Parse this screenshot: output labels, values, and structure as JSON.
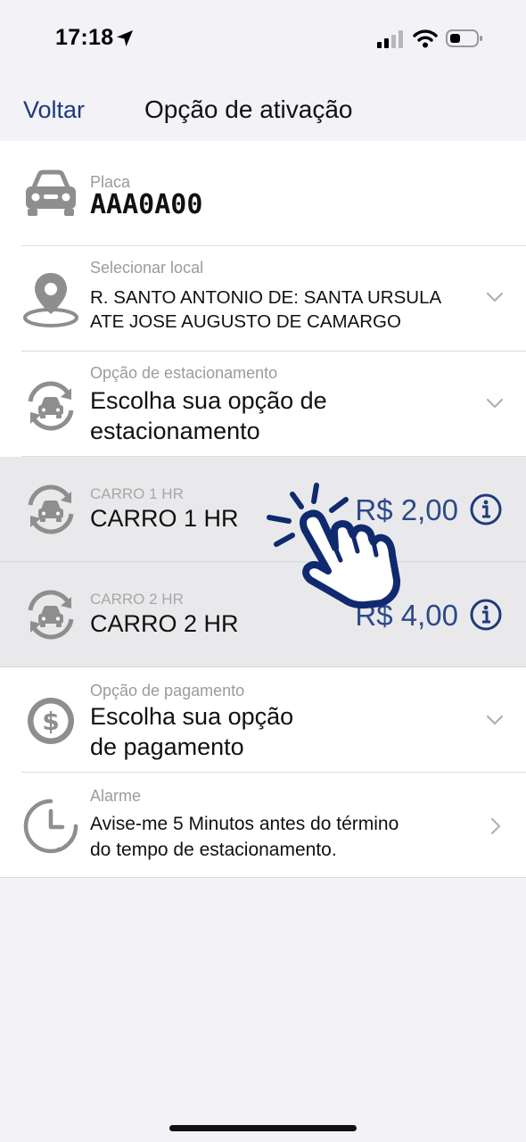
{
  "status_bar": {
    "time": "17:18"
  },
  "nav": {
    "back_label": "Voltar",
    "title": "Opção de ativação"
  },
  "plate": {
    "label": "Placa",
    "value": "AAA0A00",
    "icon": "car-icon"
  },
  "location": {
    "label": "Selecionar local",
    "value_line1": "R. SANTO ANTONIO DE: SANTA URSULA",
    "value_line2": "ATE JOSE AUGUSTO DE CAMARGO",
    "icon": "map-pin-icon"
  },
  "parking_option": {
    "label": "Opção de estacionamento",
    "value_line1": "Escolha sua opção de",
    "value_line2": "estacionamento",
    "icon": "car-cycle-icon"
  },
  "parking_choices": [
    {
      "small_label": "CARRO 1 HR",
      "title": "CARRO 1 HR",
      "price": "R$ 2,00"
    },
    {
      "small_label": "CARRO 2 HR",
      "title": "CARRO 2 HR",
      "price": "R$ 4,00"
    }
  ],
  "payment": {
    "label": "Opção de pagamento",
    "value_line1": "Escolha sua opção",
    "value_line2": "de pagamento",
    "icon": "dollar-circle-icon"
  },
  "alarm": {
    "label": "Alarme",
    "value_line1": "Avise-me 5 Minutos antes do término",
    "value_line2": "do tempo de estacionamento.",
    "icon": "clock-icon"
  },
  "colors": {
    "accent": "#1e3a7a",
    "price": "#2c4a8a",
    "icon_gray": "#8e8e8e",
    "shaded_row": "#e9e9ec",
    "background": "#f2f2f7"
  }
}
